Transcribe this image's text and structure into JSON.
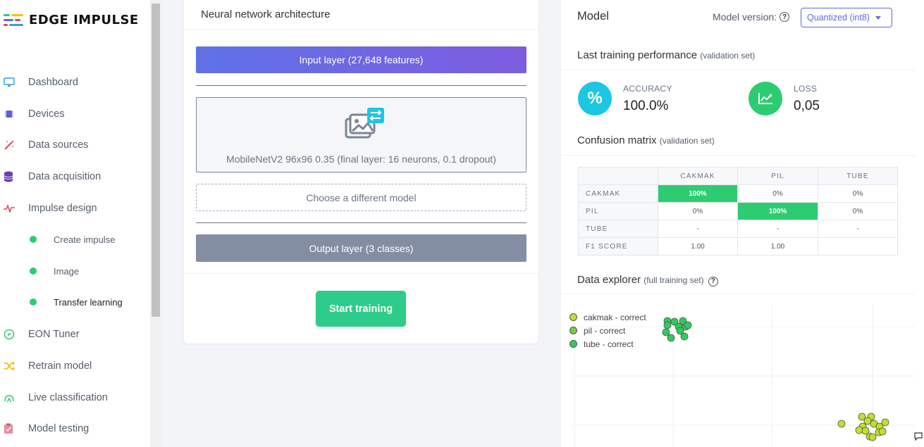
{
  "brand": {
    "name": "EDGE IMPULSE"
  },
  "sidebar": {
    "items": [
      {
        "label": "Dashboard",
        "icon": "monitor-icon",
        "color": "#3aa0d8"
      },
      {
        "label": "Devices",
        "icon": "chip-icon",
        "color": "#5b5fd8"
      },
      {
        "label": "Data sources",
        "icon": "wand-icon",
        "color": "#e0455f"
      },
      {
        "label": "Data acquisition",
        "icon": "database-icon",
        "color": "#6a3db8"
      },
      {
        "label": "Impulse design",
        "icon": "pulse-icon",
        "color": "#e0455f"
      },
      {
        "label": "EON Tuner",
        "icon": "compass-icon",
        "color": "#2ecc71"
      },
      {
        "label": "Retrain model",
        "icon": "shuffle-icon",
        "color": "#f5c400"
      },
      {
        "label": "Live classification",
        "icon": "signal-icon",
        "color": "#2ecc71"
      },
      {
        "label": "Model testing",
        "icon": "clipboard-icon",
        "color": "#e98aa0"
      }
    ],
    "subitems": [
      {
        "label": "Create impulse"
      },
      {
        "label": "Image"
      },
      {
        "label": "Transfer learning"
      }
    ]
  },
  "nn": {
    "title": "Neural network architecture",
    "input_layer": "Input layer (27,648 features)",
    "model_desc": "MobileNetV2 96x96 0.35 (final layer: 16 neurons, 0.1 dropout)",
    "choose_model": "Choose a different model",
    "output_layer": "Output layer (3 classes)",
    "start_button": "Start training"
  },
  "model": {
    "title": "Model",
    "version_label": "Model version:",
    "version_value": "Quantized (int8)",
    "perf_title": "Last training performance",
    "perf_sub": "(validation set)",
    "accuracy_label": "ACCURACY",
    "accuracy_value": "100.0%",
    "loss_label": "LOSS",
    "loss_value": "0,05",
    "cm_title": "Confusion matrix",
    "cm_sub": "(validation set)",
    "explorer_title": "Data explorer",
    "explorer_sub": "(full training set)"
  },
  "confusion_matrix": {
    "columns": [
      "CAKMAK",
      "PIL",
      "TUBE"
    ],
    "rows": [
      {
        "label": "CAKMAK",
        "cells": [
          "100%",
          "0%",
          "0%"
        ]
      },
      {
        "label": "PIL",
        "cells": [
          "0%",
          "100%",
          "0%"
        ]
      },
      {
        "label": "TUBE",
        "cells": [
          "-",
          "-",
          "-"
        ]
      },
      {
        "label": "F1 SCORE",
        "cells": [
          "1.00",
          "1.00",
          ""
        ]
      }
    ]
  },
  "explorer": {
    "legend": [
      {
        "label": "cakmak - correct",
        "color": "#bfe02c"
      },
      {
        "label": "pil - correct",
        "color": "#7ad136"
      },
      {
        "label": "tube - correct",
        "color": "#2ecc5a"
      }
    ]
  }
}
